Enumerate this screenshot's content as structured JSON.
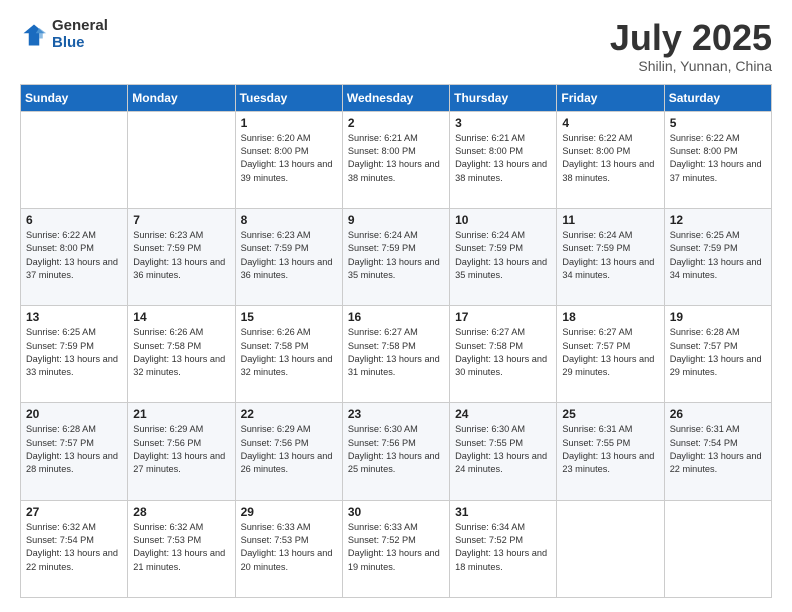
{
  "header": {
    "logo_general": "General",
    "logo_blue": "Blue",
    "month_title": "July 2025",
    "location": "Shilin, Yunnan, China"
  },
  "weekdays": [
    "Sunday",
    "Monday",
    "Tuesday",
    "Wednesday",
    "Thursday",
    "Friday",
    "Saturday"
  ],
  "weeks": [
    [
      {
        "day": "",
        "info": ""
      },
      {
        "day": "",
        "info": ""
      },
      {
        "day": "1",
        "info": "Sunrise: 6:20 AM\nSunset: 8:00 PM\nDaylight: 13 hours and 39 minutes."
      },
      {
        "day": "2",
        "info": "Sunrise: 6:21 AM\nSunset: 8:00 PM\nDaylight: 13 hours and 38 minutes."
      },
      {
        "day": "3",
        "info": "Sunrise: 6:21 AM\nSunset: 8:00 PM\nDaylight: 13 hours and 38 minutes."
      },
      {
        "day": "4",
        "info": "Sunrise: 6:22 AM\nSunset: 8:00 PM\nDaylight: 13 hours and 38 minutes."
      },
      {
        "day": "5",
        "info": "Sunrise: 6:22 AM\nSunset: 8:00 PM\nDaylight: 13 hours and 37 minutes."
      }
    ],
    [
      {
        "day": "6",
        "info": "Sunrise: 6:22 AM\nSunset: 8:00 PM\nDaylight: 13 hours and 37 minutes."
      },
      {
        "day": "7",
        "info": "Sunrise: 6:23 AM\nSunset: 7:59 PM\nDaylight: 13 hours and 36 minutes."
      },
      {
        "day": "8",
        "info": "Sunrise: 6:23 AM\nSunset: 7:59 PM\nDaylight: 13 hours and 36 minutes."
      },
      {
        "day": "9",
        "info": "Sunrise: 6:24 AM\nSunset: 7:59 PM\nDaylight: 13 hours and 35 minutes."
      },
      {
        "day": "10",
        "info": "Sunrise: 6:24 AM\nSunset: 7:59 PM\nDaylight: 13 hours and 35 minutes."
      },
      {
        "day": "11",
        "info": "Sunrise: 6:24 AM\nSunset: 7:59 PM\nDaylight: 13 hours and 34 minutes."
      },
      {
        "day": "12",
        "info": "Sunrise: 6:25 AM\nSunset: 7:59 PM\nDaylight: 13 hours and 34 minutes."
      }
    ],
    [
      {
        "day": "13",
        "info": "Sunrise: 6:25 AM\nSunset: 7:59 PM\nDaylight: 13 hours and 33 minutes."
      },
      {
        "day": "14",
        "info": "Sunrise: 6:26 AM\nSunset: 7:58 PM\nDaylight: 13 hours and 32 minutes."
      },
      {
        "day": "15",
        "info": "Sunrise: 6:26 AM\nSunset: 7:58 PM\nDaylight: 13 hours and 32 minutes."
      },
      {
        "day": "16",
        "info": "Sunrise: 6:27 AM\nSunset: 7:58 PM\nDaylight: 13 hours and 31 minutes."
      },
      {
        "day": "17",
        "info": "Sunrise: 6:27 AM\nSunset: 7:58 PM\nDaylight: 13 hours and 30 minutes."
      },
      {
        "day": "18",
        "info": "Sunrise: 6:27 AM\nSunset: 7:57 PM\nDaylight: 13 hours and 29 minutes."
      },
      {
        "day": "19",
        "info": "Sunrise: 6:28 AM\nSunset: 7:57 PM\nDaylight: 13 hours and 29 minutes."
      }
    ],
    [
      {
        "day": "20",
        "info": "Sunrise: 6:28 AM\nSunset: 7:57 PM\nDaylight: 13 hours and 28 minutes."
      },
      {
        "day": "21",
        "info": "Sunrise: 6:29 AM\nSunset: 7:56 PM\nDaylight: 13 hours and 27 minutes."
      },
      {
        "day": "22",
        "info": "Sunrise: 6:29 AM\nSunset: 7:56 PM\nDaylight: 13 hours and 26 minutes."
      },
      {
        "day": "23",
        "info": "Sunrise: 6:30 AM\nSunset: 7:56 PM\nDaylight: 13 hours and 25 minutes."
      },
      {
        "day": "24",
        "info": "Sunrise: 6:30 AM\nSunset: 7:55 PM\nDaylight: 13 hours and 24 minutes."
      },
      {
        "day": "25",
        "info": "Sunrise: 6:31 AM\nSunset: 7:55 PM\nDaylight: 13 hours and 23 minutes."
      },
      {
        "day": "26",
        "info": "Sunrise: 6:31 AM\nSunset: 7:54 PM\nDaylight: 13 hours and 22 minutes."
      }
    ],
    [
      {
        "day": "27",
        "info": "Sunrise: 6:32 AM\nSunset: 7:54 PM\nDaylight: 13 hours and 22 minutes."
      },
      {
        "day": "28",
        "info": "Sunrise: 6:32 AM\nSunset: 7:53 PM\nDaylight: 13 hours and 21 minutes."
      },
      {
        "day": "29",
        "info": "Sunrise: 6:33 AM\nSunset: 7:53 PM\nDaylight: 13 hours and 20 minutes."
      },
      {
        "day": "30",
        "info": "Sunrise: 6:33 AM\nSunset: 7:52 PM\nDaylight: 13 hours and 19 minutes."
      },
      {
        "day": "31",
        "info": "Sunrise: 6:34 AM\nSunset: 7:52 PM\nDaylight: 13 hours and 18 minutes."
      },
      {
        "day": "",
        "info": ""
      },
      {
        "day": "",
        "info": ""
      }
    ]
  ]
}
